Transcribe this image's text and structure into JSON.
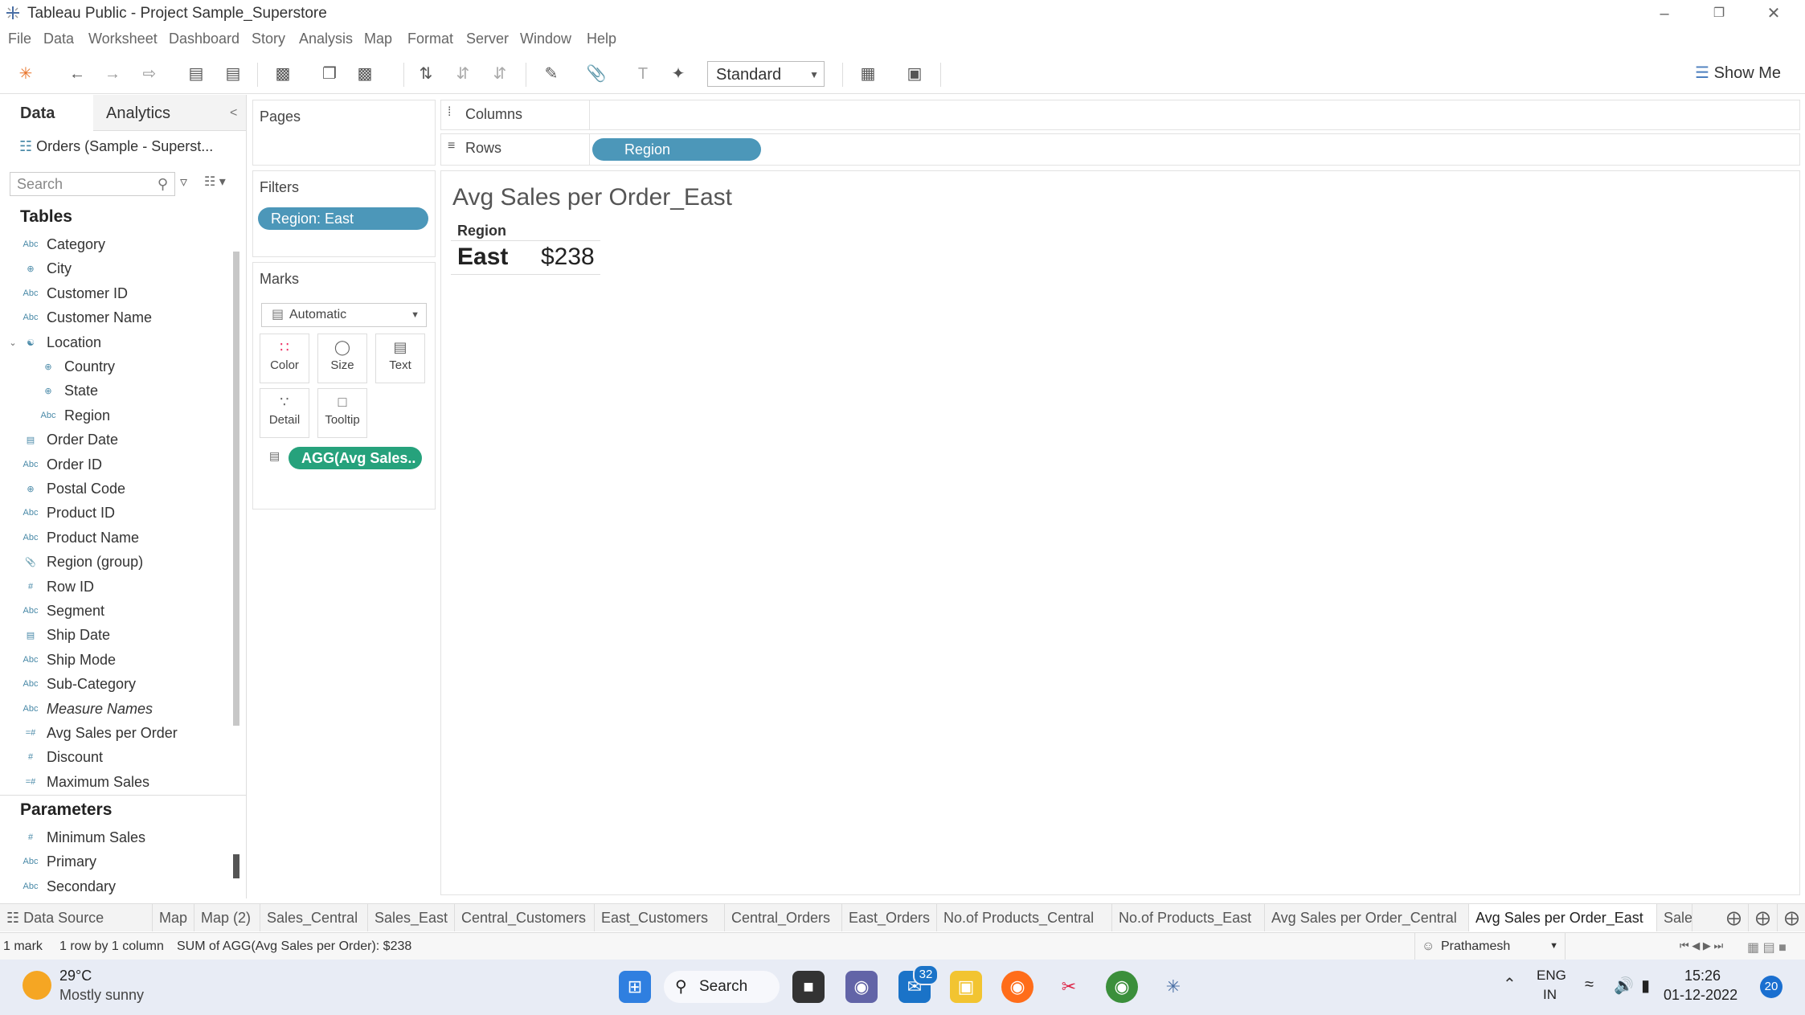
{
  "window": {
    "title": "Tableau Public - Project Sample_Superstore"
  },
  "menu": [
    "File",
    "Data",
    "Worksheet",
    "Dashboard",
    "Story",
    "Analysis",
    "Map",
    "Format",
    "Server",
    "Window",
    "Help"
  ],
  "toolbar": {
    "fit_select": "Standard",
    "show_me": "Show Me"
  },
  "datapane": {
    "tab_data": "Data",
    "tab_analytics": "Analytics",
    "datasource": "Orders (Sample - Superst...",
    "search_placeholder": "Search",
    "tables_heading": "Tables",
    "fields": [
      {
        "name": "Category",
        "type": "Abc"
      },
      {
        "name": "City",
        "type": "geo"
      },
      {
        "name": "Customer ID",
        "type": "Abc"
      },
      {
        "name": "Customer Name",
        "type": "Abc"
      },
      {
        "name": "Location",
        "type": "hier"
      },
      {
        "name": "Country",
        "type": "geo"
      },
      {
        "name": "State",
        "type": "geo"
      },
      {
        "name": "Region",
        "type": "Abc"
      },
      {
        "name": "Order Date",
        "type": "date"
      },
      {
        "name": "Order ID",
        "type": "Abc"
      },
      {
        "name": "Postal Code",
        "type": "geo"
      },
      {
        "name": "Product ID",
        "type": "Abc"
      },
      {
        "name": "Product Name",
        "type": "Abc"
      },
      {
        "name": "Region (group)",
        "type": "group"
      },
      {
        "name": "Row ID",
        "type": "#"
      },
      {
        "name": "Segment",
        "type": "Abc"
      },
      {
        "name": "Ship Date",
        "type": "date"
      },
      {
        "name": "Ship Mode",
        "type": "Abc"
      },
      {
        "name": "Sub-Category",
        "type": "Abc"
      },
      {
        "name": "Measure Names",
        "type": "Abc"
      },
      {
        "name": "Avg Sales per Order",
        "type": "=#"
      },
      {
        "name": "Discount",
        "type": "#"
      },
      {
        "name": "Maximum Sales",
        "type": "=#"
      }
    ],
    "parameters_heading": "Parameters",
    "parameters": [
      {
        "name": "Minimum Sales",
        "type": "#"
      },
      {
        "name": "Primary",
        "type": "Abc"
      },
      {
        "name": "Secondary",
        "type": "Abc"
      }
    ]
  },
  "shelves": {
    "pages": "Pages",
    "filters": "Filters",
    "filter_pill": "Region: East",
    "marks": "Marks",
    "mark_type": "Automatic",
    "mark_buttons": [
      "Color",
      "Size",
      "Text",
      "Detail",
      "Tooltip"
    ],
    "mark_pill": "AGG(Avg Sales..",
    "columns": "Columns",
    "rows": "Rows",
    "rows_pill": "Region"
  },
  "viz": {
    "title": "Avg Sales per Order_East",
    "header": "Region",
    "region": "East",
    "value": "$238"
  },
  "sheet_tabs": [
    "Data Source",
    "Map",
    "Map (2)",
    "Sales_Central",
    "Sales_East",
    "Central_Customers",
    "East_Customers",
    "Central_Orders",
    "East_Orders",
    "No.of Products_Central",
    "No.of Products_East",
    "Avg Sales per Order_Central",
    "Avg Sales per Order_East",
    "Sales_t"
  ],
  "active_tab": "Avg Sales per Order_East",
  "status": {
    "marks": "1 mark",
    "dims": "1 row by 1 column",
    "sum": "SUM of AGG(Avg Sales per Order): $238",
    "user": "Prathamesh"
  },
  "taskbar": {
    "temp": "29°C",
    "weather": "Mostly sunny",
    "search": "Search",
    "mail_badge": "32",
    "lang1": "ENG",
    "lang2": "IN",
    "time": "15:26",
    "date": "01-12-2022",
    "notif": "20"
  },
  "colors": {
    "pill_blue": "#4c97b9",
    "pill_green": "#26a27c"
  }
}
